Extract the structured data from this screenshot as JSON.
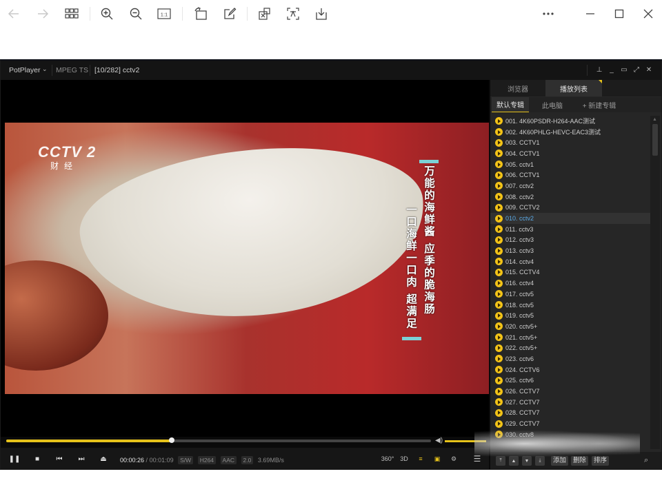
{
  "viewer_toolbar": {
    "buttons": [
      "back-arrow-icon",
      "forward-arrow-icon",
      "grid-icon",
      "zoom-in-icon",
      "zoom-out-icon",
      "actual-size-icon",
      "rotate-icon",
      "edit-icon",
      "ocr-icon",
      "translate-icon",
      "download-icon",
      "more-icon",
      "minimize-icon",
      "maximize-icon",
      "close-icon"
    ],
    "actual_size_label": "1:1"
  },
  "player": {
    "app_name": "PotPlayer",
    "format": "MPEG TS",
    "title": "[10/282] cctv2",
    "channel_logo": "CCTV 2",
    "channel_sub": "财经",
    "subtitle_right": "万能的海鲜酱 应季的脆海肠",
    "subtitle_left": "一口海鲜一口肉 超满足",
    "progress": 0.39,
    "volume": 1.0
  },
  "controls": {
    "time_current": "00:00:26",
    "time_sep": " / ",
    "time_total": "00:01:09",
    "chips": [
      "S/W",
      "H264",
      "AAC",
      "2.0"
    ],
    "bitrate": "3.69MB/s",
    "right_icons": [
      "360°",
      "3D"
    ]
  },
  "panel": {
    "tabs": [
      "浏览器",
      "播放列表"
    ],
    "subtabs": [
      "默认专辑",
      "此电脑",
      "+ 新建专辑"
    ],
    "current_index": 9,
    "items": [
      "001. 4K60PSDR-H264-AAC测试",
      "002. 4K60PHLG-HEVC-EAC3测试",
      "003. CCTV1",
      "004. CCTV1",
      "005. cctv1",
      "006. CCTV1",
      "007. cctv2",
      "008. cctv2",
      "009. CCTV2",
      "010. cctv2",
      "011. cctv3",
      "012. cctv3",
      "013. cctv3",
      "014. cctv4",
      "015. CCTV4",
      "016. cctv4",
      "017. cctv5",
      "018. cctv5",
      "019. cctv5",
      "020. cctv5+",
      "021. cctv5+",
      "022. cctv5+",
      "023. cctv6",
      "024. CCTV6",
      "025. cctv6",
      "026. CCTV7",
      "027. CCTV7",
      "028. CCTV7",
      "029. CCTV7",
      "030. cctv8"
    ],
    "footer": {
      "add": "添加",
      "delete": "删除",
      "sort": "排序"
    }
  }
}
